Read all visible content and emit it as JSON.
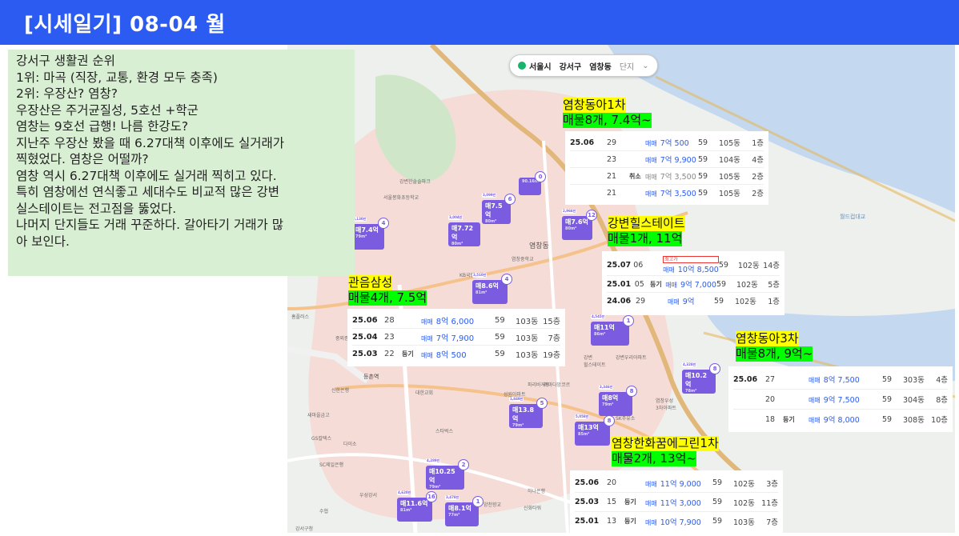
{
  "header": {
    "title": "[시세일기] 08-04 월"
  },
  "note": {
    "lines": [
      "강서구 생활권 순위",
      "1위: 마곡 (직장, 교통, 환경 모두 충족)",
      "2위: 우장산? 염창?",
      "우장산은 주거균질성, 5호선 +학군",
      "염창는 9호선 급행! 나름 한강도?",
      "",
      "지난주 우장산 봤을 때 6.27대책 이후에도 실거래가",
      "찍혔었다. 염창은 어떨까?",
      "염창 역시 6.27대책 이후에도 실거래 찍히고 있다.",
      "특히 염창에선 연식좋고 세대수도 비교적 많은 강변",
      "실스테이트는 전고점을 뚫었다.",
      "나머지 단지들도 거래 꾸준하다. 갈아타기 거래가 많",
      "아 보인다."
    ]
  },
  "location_bar": {
    "city": "서울시",
    "district": "강서구",
    "dong": "염창동",
    "complex": "단지"
  },
  "markers": [
    {
      "price": "매7.4억",
      "area": "79m²",
      "count": "4",
      "tag": "3,130만"
    },
    {
      "price": "매7.72억",
      "area": "80m²",
      "count": "",
      "tag": "3,004만"
    },
    {
      "price": "매7.5억",
      "area": "80m²",
      "count": "6",
      "tag": "3,099만"
    },
    {
      "price": "",
      "area": "",
      "count": "0",
      "tag": "90.16m²"
    },
    {
      "price": "매7.6억",
      "area": "80m²",
      "count": "12",
      "tag": "2,966만"
    },
    {
      "price": "매8.6억",
      "area": "81m²",
      "count": "4",
      "tag": "3,510만"
    },
    {
      "price": "매11억",
      "area": "86m²",
      "count": "1",
      "tag": "4,545만"
    },
    {
      "price": "매10.2억",
      "area": "78m²",
      "count": "8",
      "tag": "4,328만"
    },
    {
      "price": "매8억",
      "area": "79m²",
      "count": "8",
      "tag": "3,346만"
    },
    {
      "price": "매13.8억",
      "area": "79m²",
      "count": "5",
      "tag": "1,849만"
    },
    {
      "price": "매13억",
      "area": "85m²",
      "count": "8",
      "tag": "5,058만"
    },
    {
      "price": "매10.25억",
      "area": "79m²",
      "count": "2",
      "tag": "4,289만"
    },
    {
      "price": "매11.6억",
      "area": "81m²",
      "count": "16",
      "tag": "4,620만"
    },
    {
      "price": "매8.1억",
      "area": "77m²",
      "count": "1",
      "tag": "3,478만"
    }
  ],
  "place_labels": [
    "염창동",
    "강변한솔솔파크",
    "서울봉화초등학교",
    "염창중학교",
    "강변",
    "힐스테이트",
    "강변우리아파트",
    "등촌역",
    "성원아파트",
    "대한교회",
    "스타벅스",
    "SC제일은행",
    "다이소",
    "GS칼텍스",
    "새마을금고",
    "하나은행",
    "신화타워",
    "양천향교",
    "KB국민은행",
    "라마다앙코르",
    "염창우성",
    "3차아파트",
    "SK주유소",
    "홈플러스",
    "수협",
    "신한은행",
    "우성강서",
    "파리바게트",
    "중외증권",
    "강서구청"
  ],
  "complexes": [
    {
      "name": "염창동아1차",
      "summary": "매물8개, 7.4억~",
      "trades": [
        {
          "date": "25.06",
          "day": "29",
          "cancel": "",
          "type": "매매",
          "price": "7억 500",
          "size": "59",
          "building": "105동",
          "floor": "1층",
          "gray": false
        },
        {
          "date": "",
          "day": "23",
          "cancel": "",
          "type": "매매",
          "price": "7억 9,900",
          "size": "59",
          "building": "104동",
          "floor": "4층",
          "gray": false
        },
        {
          "date": "",
          "day": "21",
          "cancel": "취소",
          "type": "매매",
          "price": "7억 3,500",
          "size": "59",
          "building": "105동",
          "floor": "2층",
          "gray": true
        },
        {
          "date": "",
          "day": "21",
          "cancel": "",
          "type": "매매",
          "price": "7억 3,500",
          "size": "59",
          "building": "105동",
          "floor": "2층",
          "gray": false
        }
      ]
    },
    {
      "name": "강변힐스테이트",
      "summary": "매물1개, 11억",
      "trades": [
        {
          "date": "25.07",
          "day": "06",
          "cancel": "",
          "type": "매매",
          "price": "10억 8,500",
          "size": "59",
          "building": "102동",
          "floor": "14층",
          "gray": false,
          "badge": "최고가"
        },
        {
          "date": "25.01",
          "day": "05",
          "cancel": "등기",
          "type": "매매",
          "price": "9억 7,000",
          "size": "59",
          "building": "102동",
          "floor": "5층",
          "gray": false
        },
        {
          "date": "24.06",
          "day": "29",
          "cancel": "",
          "type": "매매",
          "price": "9억",
          "size": "59",
          "building": "102동",
          "floor": "1층",
          "gray": false
        }
      ]
    },
    {
      "name": "관음삼성",
      "summary": "매물4개, 7.5억",
      "trades": [
        {
          "date": "25.06",
          "day": "28",
          "cancel": "",
          "type": "매매",
          "price": "8억 6,000",
          "size": "59",
          "building": "103동",
          "floor": "15층",
          "gray": false
        },
        {
          "date": "25.04",
          "day": "23",
          "cancel": "",
          "type": "매매",
          "price": "7억 7,900",
          "size": "59",
          "building": "103동",
          "floor": "7층",
          "gray": false
        },
        {
          "date": "25.03",
          "day": "22",
          "cancel": "등기",
          "type": "매매",
          "price": "8억 500",
          "size": "59",
          "building": "103동",
          "floor": "19층",
          "gray": false
        }
      ]
    },
    {
      "name": "염창동아3차",
      "summary": "매물8개, 9억~",
      "trades": [
        {
          "date": "25.06",
          "day": "27",
          "cancel": "",
          "type": "매매",
          "price": "8억 7,500",
          "size": "59",
          "building": "303동",
          "floor": "4층",
          "gray": false
        },
        {
          "date": "",
          "day": "20",
          "cancel": "",
          "type": "매매",
          "price": "9억 7,500",
          "size": "59",
          "building": "304동",
          "floor": "8층",
          "gray": false
        },
        {
          "date": "",
          "day": "18",
          "cancel": "등기",
          "type": "매매",
          "price": "9억 8,000",
          "size": "59",
          "building": "308동",
          "floor": "10층",
          "gray": false
        }
      ]
    },
    {
      "name": "염창한화꿈에그린1차",
      "summary": "매물2개, 13억~",
      "trades": [
        {
          "date": "25.06",
          "day": "20",
          "cancel": "",
          "type": "매매",
          "price": "11억 9,000",
          "size": "59",
          "building": "102동",
          "floor": "3층",
          "gray": false
        },
        {
          "date": "25.03",
          "day": "15",
          "cancel": "등기",
          "type": "매매",
          "price": "11억 3,000",
          "size": "59",
          "building": "102동",
          "floor": "11층",
          "gray": false
        },
        {
          "date": "25.01",
          "day": "13",
          "cancel": "등기",
          "type": "매매",
          "price": "10억 7,900",
          "size": "59",
          "building": "103동",
          "floor": "7층",
          "gray": false
        }
      ]
    }
  ],
  "colors": {
    "header": "#2b5bf0",
    "note_bg": "#d9efd3",
    "marker": "#7b5ce0",
    "label_yellow": "#ffff00",
    "label_green": "#00ff00",
    "river": "#c4d9ef",
    "district": "#f6dcd7"
  }
}
